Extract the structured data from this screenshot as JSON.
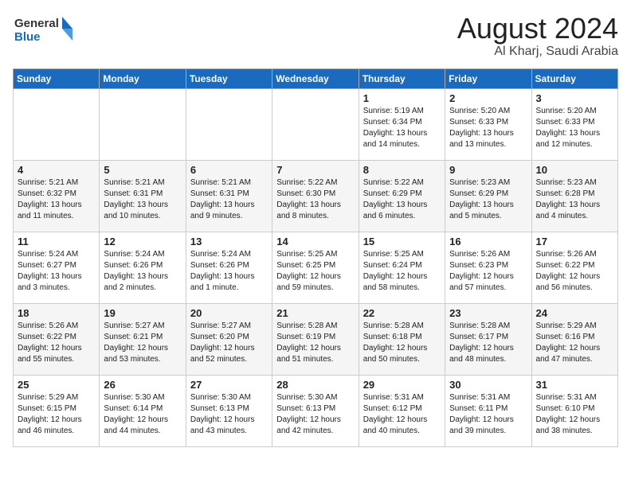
{
  "logo": {
    "line1": "General",
    "line2": "Blue"
  },
  "calendar": {
    "title": "August 2024",
    "subtitle": "Al Kharj, Saudi Arabia"
  },
  "days_of_week": [
    "Sunday",
    "Monday",
    "Tuesday",
    "Wednesday",
    "Thursday",
    "Friday",
    "Saturday"
  ],
  "weeks": [
    [
      {
        "day": "",
        "text": ""
      },
      {
        "day": "",
        "text": ""
      },
      {
        "day": "",
        "text": ""
      },
      {
        "day": "",
        "text": ""
      },
      {
        "day": "1",
        "text": "Sunrise: 5:19 AM\nSunset: 6:34 PM\nDaylight: 13 hours\nand 14 minutes."
      },
      {
        "day": "2",
        "text": "Sunrise: 5:20 AM\nSunset: 6:33 PM\nDaylight: 13 hours\nand 13 minutes."
      },
      {
        "day": "3",
        "text": "Sunrise: 5:20 AM\nSunset: 6:33 PM\nDaylight: 13 hours\nand 12 minutes."
      }
    ],
    [
      {
        "day": "4",
        "text": "Sunrise: 5:21 AM\nSunset: 6:32 PM\nDaylight: 13 hours\nand 11 minutes."
      },
      {
        "day": "5",
        "text": "Sunrise: 5:21 AM\nSunset: 6:31 PM\nDaylight: 13 hours\nand 10 minutes."
      },
      {
        "day": "6",
        "text": "Sunrise: 5:21 AM\nSunset: 6:31 PM\nDaylight: 13 hours\nand 9 minutes."
      },
      {
        "day": "7",
        "text": "Sunrise: 5:22 AM\nSunset: 6:30 PM\nDaylight: 13 hours\nand 8 minutes."
      },
      {
        "day": "8",
        "text": "Sunrise: 5:22 AM\nSunset: 6:29 PM\nDaylight: 13 hours\nand 6 minutes."
      },
      {
        "day": "9",
        "text": "Sunrise: 5:23 AM\nSunset: 6:29 PM\nDaylight: 13 hours\nand 5 minutes."
      },
      {
        "day": "10",
        "text": "Sunrise: 5:23 AM\nSunset: 6:28 PM\nDaylight: 13 hours\nand 4 minutes."
      }
    ],
    [
      {
        "day": "11",
        "text": "Sunrise: 5:24 AM\nSunset: 6:27 PM\nDaylight: 13 hours\nand 3 minutes."
      },
      {
        "day": "12",
        "text": "Sunrise: 5:24 AM\nSunset: 6:26 PM\nDaylight: 13 hours\nand 2 minutes."
      },
      {
        "day": "13",
        "text": "Sunrise: 5:24 AM\nSunset: 6:26 PM\nDaylight: 13 hours\nand 1 minute."
      },
      {
        "day": "14",
        "text": "Sunrise: 5:25 AM\nSunset: 6:25 PM\nDaylight: 12 hours\nand 59 minutes."
      },
      {
        "day": "15",
        "text": "Sunrise: 5:25 AM\nSunset: 6:24 PM\nDaylight: 12 hours\nand 58 minutes."
      },
      {
        "day": "16",
        "text": "Sunrise: 5:26 AM\nSunset: 6:23 PM\nDaylight: 12 hours\nand 57 minutes."
      },
      {
        "day": "17",
        "text": "Sunrise: 5:26 AM\nSunset: 6:22 PM\nDaylight: 12 hours\nand 56 minutes."
      }
    ],
    [
      {
        "day": "18",
        "text": "Sunrise: 5:26 AM\nSunset: 6:22 PM\nDaylight: 12 hours\nand 55 minutes."
      },
      {
        "day": "19",
        "text": "Sunrise: 5:27 AM\nSunset: 6:21 PM\nDaylight: 12 hours\nand 53 minutes."
      },
      {
        "day": "20",
        "text": "Sunrise: 5:27 AM\nSunset: 6:20 PM\nDaylight: 12 hours\nand 52 minutes."
      },
      {
        "day": "21",
        "text": "Sunrise: 5:28 AM\nSunset: 6:19 PM\nDaylight: 12 hours\nand 51 minutes."
      },
      {
        "day": "22",
        "text": "Sunrise: 5:28 AM\nSunset: 6:18 PM\nDaylight: 12 hours\nand 50 minutes."
      },
      {
        "day": "23",
        "text": "Sunrise: 5:28 AM\nSunset: 6:17 PM\nDaylight: 12 hours\nand 48 minutes."
      },
      {
        "day": "24",
        "text": "Sunrise: 5:29 AM\nSunset: 6:16 PM\nDaylight: 12 hours\nand 47 minutes."
      }
    ],
    [
      {
        "day": "25",
        "text": "Sunrise: 5:29 AM\nSunset: 6:15 PM\nDaylight: 12 hours\nand 46 minutes."
      },
      {
        "day": "26",
        "text": "Sunrise: 5:30 AM\nSunset: 6:14 PM\nDaylight: 12 hours\nand 44 minutes."
      },
      {
        "day": "27",
        "text": "Sunrise: 5:30 AM\nSunset: 6:13 PM\nDaylight: 12 hours\nand 43 minutes."
      },
      {
        "day": "28",
        "text": "Sunrise: 5:30 AM\nSunset: 6:13 PM\nDaylight: 12 hours\nand 42 minutes."
      },
      {
        "day": "29",
        "text": "Sunrise: 5:31 AM\nSunset: 6:12 PM\nDaylight: 12 hours\nand 40 minutes."
      },
      {
        "day": "30",
        "text": "Sunrise: 5:31 AM\nSunset: 6:11 PM\nDaylight: 12 hours\nand 39 minutes."
      },
      {
        "day": "31",
        "text": "Sunrise: 5:31 AM\nSunset: 6:10 PM\nDaylight: 12 hours\nand 38 minutes."
      }
    ]
  ]
}
